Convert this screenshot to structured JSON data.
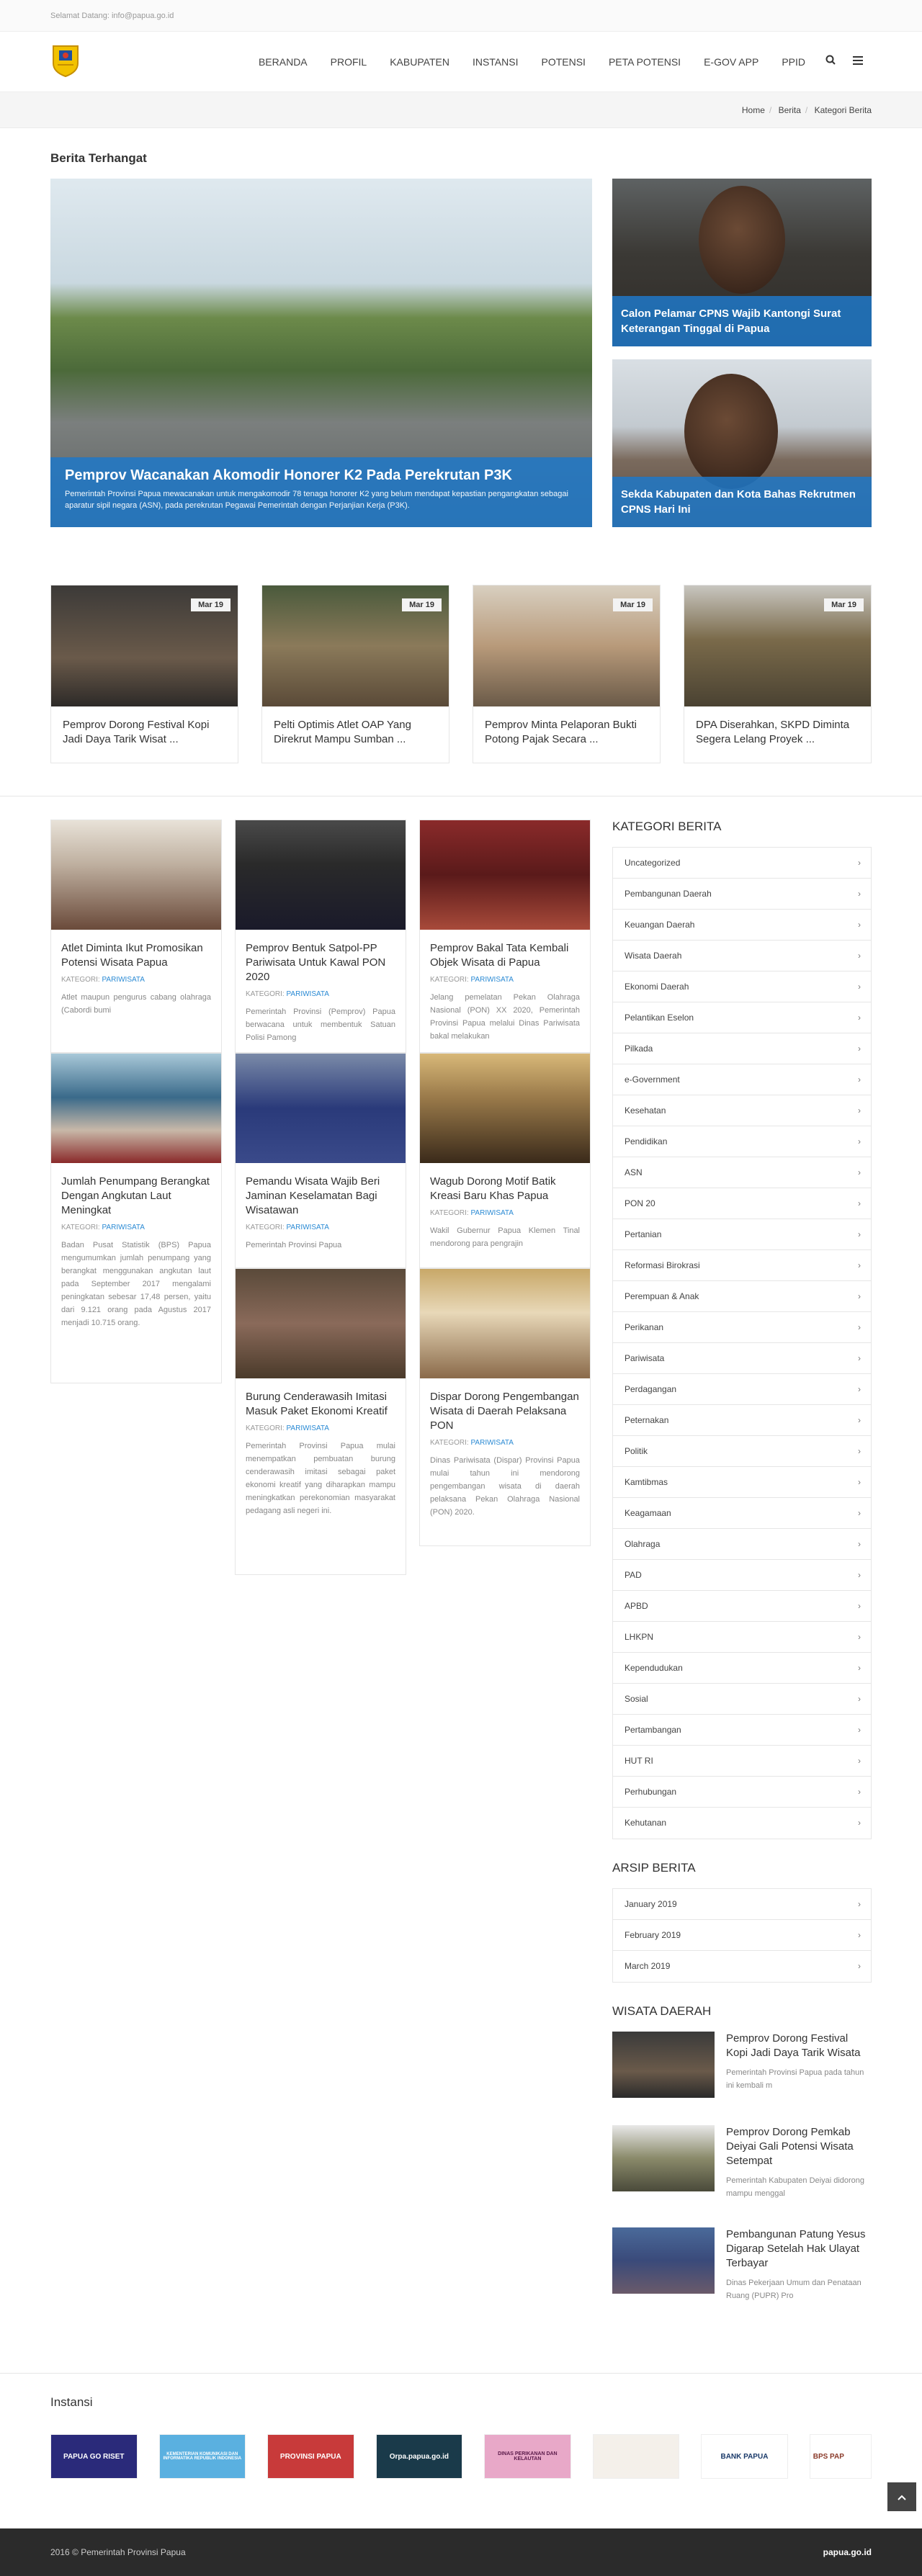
{
  "topbar": {
    "text": "Selamat Datang: info@papua.go.id"
  },
  "nav": {
    "items": [
      "BERANDA",
      "PROFIL",
      "KABUPATEN",
      "INSTANSI",
      "POTENSI",
      "PETA POTENSI",
      "E-GOV APP",
      "PPID"
    ],
    "search_icon": "search-icon",
    "menu_icon": "list-icon"
  },
  "breadcrumb": {
    "home": "Home",
    "mid": "Berita",
    "current": "Kategori Berita"
  },
  "featured": {
    "section_title": "Berita Terhangat",
    "big": {
      "title": "Pemprov Wacanakan Akomodir Honorer K2 Pada Perekrutan P3K",
      "excerpt": "Pemerintah Provinsi Papua mewacanakan untuk mengakomodir 78 tenaga honorer K2 yang belum mendapat kepastian pengangkatan sebagai aparatur sipil negara (ASN), pada perekrutan Pegawai Pemerintah dengan Perjanjian Kerja (P3K)."
    },
    "side1": {
      "title": "Calon Pelamar CPNS Wajib Kantongi Surat Keterangan Tinggal di Papua"
    },
    "side2": {
      "title": "Sekda Kabupaten dan Kota Bahas Rekrutmen CPNS Hari Ini"
    }
  },
  "cards": [
    {
      "date": "Mar 19",
      "title": "Pemprov Dorong Festival Kopi Jadi Daya Tarik Wisat ..."
    },
    {
      "date": "Mar 19",
      "title": "Pelti Optimis Atlet OAP Yang Direkrut Mampu Sumban ..."
    },
    {
      "date": "Mar 19",
      "title": "Pemprov Minta Pelaporan Bukti Potong Pajak Secara ..."
    },
    {
      "date": "Mar 19",
      "title": "DPA Diserahkan, SKPD Diminta Segera Lelang Proyek ..."
    }
  ],
  "category_label": "KATEGORI:",
  "posts": {
    "col1": [
      {
        "title": "Atlet Diminta Ikut Promosikan Potensi Wisata Papua",
        "cat": "PARIWISATA",
        "excerpt": "Atlet maupun pengurus cabang olahraga (Cabordi bumi"
      },
      {
        "title": "Jumlah Penumpang Berangkat Dengan Angkutan Laut Meningkat",
        "cat": "PARIWISATA",
        "excerpt": "Badan Pusat Statistik (BPS) Papua mengumumkan jumlah penumpang yang berangkat menggunakan angkutan laut pada September 2017 mengalami peningkatan sebesar 17,48 persen, yaitu dari 9.121 orang pada Agustus 2017 menjadi 10.715 orang."
      }
    ],
    "col2": [
      {
        "title": "Pemprov Bentuk Satpol-PP Pariwisata Untuk Kawal PON 2020",
        "cat": "PARIWISATA",
        "excerpt": "Pemerintah Provinsi (Pemprov) Papua berwacana untuk membentuk Satuan Polisi Pamong"
      },
      {
        "title": "Pemandu Wisata Wajib Beri Jaminan Keselamatan Bagi Wisatawan",
        "cat": "PARIWISATA",
        "excerpt": "Pemerintah Provinsi Papua"
      },
      {
        "title": "Burung Cenderawasih Imitasi Masuk Paket Ekonomi Kreatif",
        "cat": "PARIWISATA",
        "excerpt": "Pemerintah Provinsi Papua mulai menempatkan pembuatan burung cenderawasih imitasi sebagai paket ekonomi kreatif yang diharapkan mampu meningkatkan perekonomian masyarakat pedagang asli negeri ini."
      }
    ],
    "col3": [
      {
        "title": "Pemprov Bakal Tata Kembali Objek Wisata di Papua",
        "cat": "PARIWISATA",
        "excerpt": "Jelang pemelatan Pekan Olahraga Nasional (PON) XX 2020, Pemerintah Provinsi Papua melalui Dinas Pariwisata bakal melakukan"
      },
      {
        "title": "Wagub Dorong Motif Batik Kreasi Baru Khas Papua",
        "cat": "PARIWISATA",
        "excerpt": "Wakil Gubernur Papua Klemen Tinal mendorong para pengrajin"
      },
      {
        "title": "Dispar Dorong Pengembangan Wisata di Daerah Pelaksana PON",
        "cat": "PARIWISATA",
        "excerpt": "Dinas Pariwisata (Dispar) Provinsi Papua mulai tahun ini mendorong pengembangan wisata di daerah pelaksana Pekan Olahraga Nasional (PON) 2020."
      }
    ]
  },
  "sidebar": {
    "kategori_title": "KATEGORI BERITA",
    "kategori": [
      "Uncategorized",
      "Pembangunan Daerah",
      "Keuangan Daerah",
      "Wisata Daerah",
      "Ekonomi Daerah",
      "Pelantikan Eselon",
      "Pilkada",
      "e-Government",
      "Kesehatan",
      "Pendidikan",
      "ASN",
      "PON 20",
      "Pertanian",
      "Reformasi Birokrasi",
      "Perempuan & Anak",
      "Perikanan",
      "Pariwisata",
      "Perdagangan",
      "Peternakan",
      "Politik",
      "Kamtibmas",
      "Keagamaan",
      "Olahraga",
      "PAD",
      "APBD",
      "LHKPN",
      "Kependudukan",
      "Sosial",
      "Pertambangan",
      "HUT RI",
      "Perhubungan",
      "Kehutanan"
    ],
    "arsip_title": "ARSIP BERITA",
    "arsip": [
      "January 2019",
      "February 2019",
      "March 2019"
    ],
    "wisata_title": "WISATA DAERAH",
    "wisata": [
      {
        "title": "Pemprov Dorong Festival Kopi Jadi Daya Tarik Wisata",
        "excerpt": "Pemerintah Provinsi Papua pada tahun ini kembali m"
      },
      {
        "title": "Pemprov Dorong Pemkab Deiyai Gali Potensi Wisata Setempat",
        "excerpt": "Pemerintah Kabupaten Deiyai didorong mampu menggal"
      },
      {
        "title": "Pembangunan Patung Yesus Digarap Setelah Hak Ulayat Terbayar",
        "excerpt": "Dinas Pekerjaan Umum dan Penataan Ruang (PUPR) Pro"
      }
    ]
  },
  "instansi": {
    "title": "Instansi",
    "logos": [
      "PAPUA GO RISET",
      "KEMENTERIAN KOMUNIKASI DAN INFORMATIKA REPUBLIK INDONESIA",
      "PROVINSI PAPUA",
      "Orpa.papua.go.id",
      "DINAS PERIKANAN DAN KELAUTAN",
      "",
      "BANK PAPUA",
      "BPS PAP"
    ]
  },
  "footer": {
    "copyright": "2016 © Pemerintah Provinsi Papua",
    "brand": "papua.go.id"
  },
  "colors": {
    "accent": "#2a8ad4",
    "caption_bg": "#1e78c8",
    "footer_bg": "#2b2b2b"
  }
}
